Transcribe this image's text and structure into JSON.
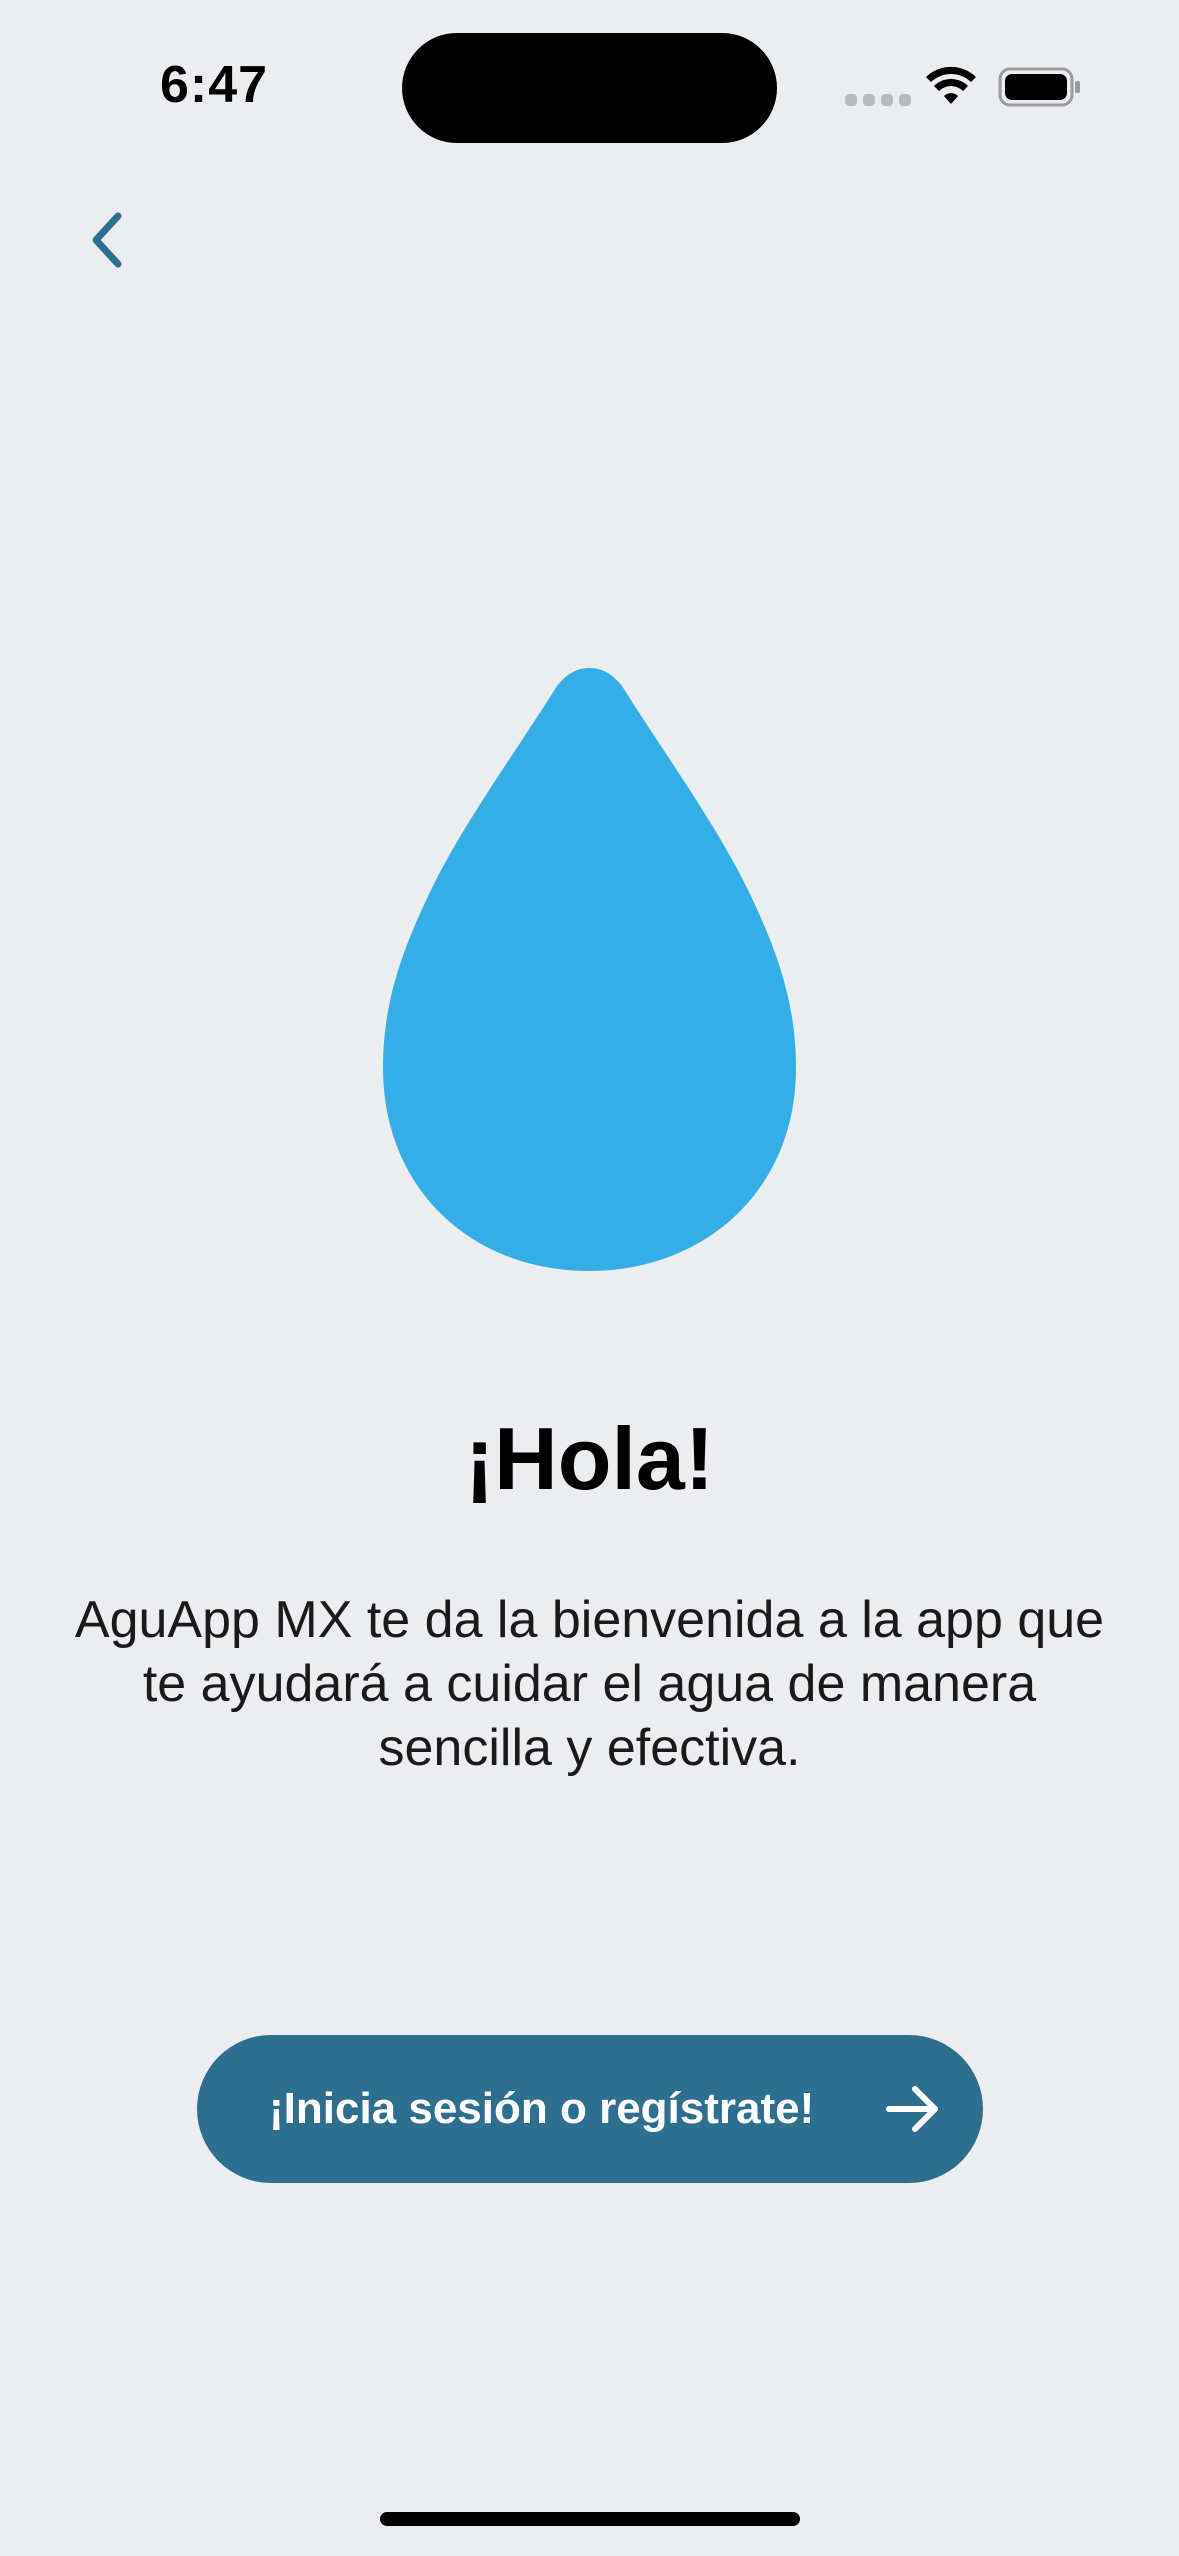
{
  "status_bar": {
    "time": "6:47",
    "icons": [
      "signal-icon",
      "wifi-icon",
      "battery-icon"
    ]
  },
  "nav": {
    "back_icon": "chevron-left-icon"
  },
  "hero": {
    "icon": "water-drop-icon",
    "drop_color": "#35aee8"
  },
  "content": {
    "title": "¡Hola!",
    "description": "AguApp MX te da la bienvenida a la app que te ayudará a cuidar el agua de manera sencilla y efectiva."
  },
  "cta": {
    "label": "¡Inicia sesión o regístrate!",
    "icon": "arrow-right-icon",
    "background": "#2e6e8e"
  },
  "colors": {
    "background": "#ebedf0",
    "accent": "#2e6e8e",
    "drop": "#35aee8"
  }
}
